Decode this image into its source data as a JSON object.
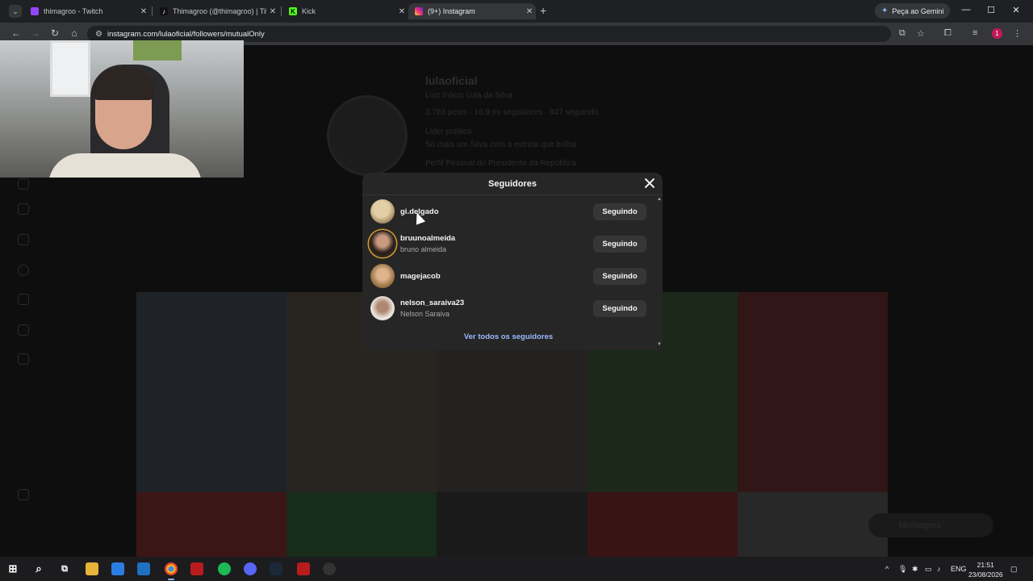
{
  "browser": {
    "tabs": [
      {
        "title": "thimagroo - Twitch",
        "icon": "twitch-icon",
        "color": "#9146ff"
      },
      {
        "title": "Thimagroo (@thimagroo) | TikTok",
        "icon": "tiktok-icon",
        "color": "#000000"
      },
      {
        "title": "Kick",
        "icon": "kick-icon",
        "color": "#53fc18"
      },
      {
        "title": "(9+) Instagram",
        "icon": "instagram-icon",
        "color": "#e1306c"
      }
    ],
    "gemini_label": "Peça ao Gemini",
    "url": "instagram.com/lulaoficial/followers/mutualOnly",
    "profile_initial": "1"
  },
  "profile_bg": {
    "username": "lulaoficial",
    "fullname": "Luiz Inácio Lula da Silva",
    "stats": "3.763 posts · 16,9 mi seguidores · 847 seguindo",
    "category": "Líder político",
    "bio_1": "Só mais um Silva com a estrela que brilha",
    "bio_2": "Perfil Pessoal do Presidente da República",
    "messages_label": "Mensagens"
  },
  "modal": {
    "title": "Seguidores",
    "followers": [
      {
        "username": "gi.delgado",
        "fullname": "",
        "button": "Seguindo",
        "avatar_color": "#c9b089"
      },
      {
        "username": "bruunoalmeida",
        "fullname": "bruno almeida",
        "button": "Seguindo",
        "avatar_color": "#3a2a22",
        "ring": true
      },
      {
        "username": "magejacob",
        "fullname": "",
        "button": "Seguindo",
        "avatar_color": "#b58e5e"
      },
      {
        "username": "nelson_saraiva23",
        "fullname": "Nelson Saraiva",
        "button": "Seguindo",
        "avatar_color": "#d8d4cf"
      }
    ],
    "see_all": "Ver todos os seguidores"
  },
  "taskbar": {
    "language": "ENG",
    "time": "21:51",
    "date": "23/08/2026"
  },
  "colors": {
    "accent_link": "#9cb9ff",
    "modal_bg": "#262626",
    "button_bg": "#363636"
  }
}
